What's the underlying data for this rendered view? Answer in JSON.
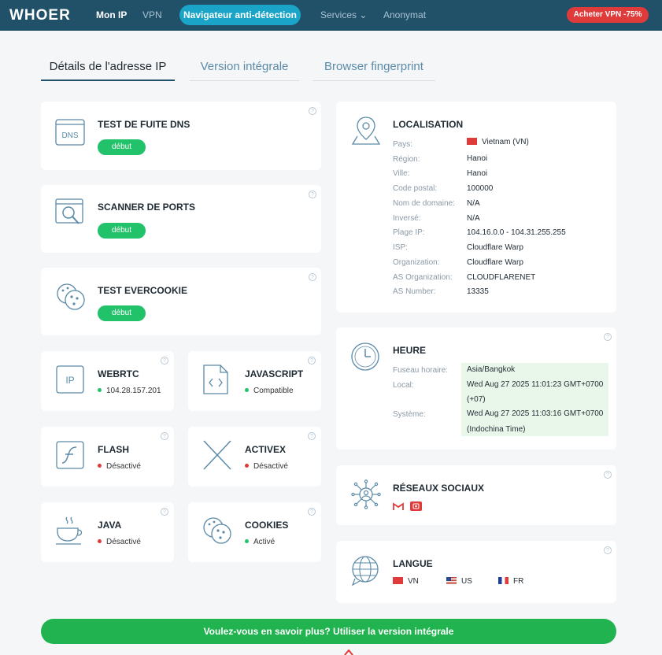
{
  "nav": {
    "logo": "WHOER",
    "items": [
      "Mon IP",
      "VPN",
      "Navigateur anti-détection",
      "Services ⌄",
      "Anonymat"
    ],
    "buy_label": "Acheter VPN -75%"
  },
  "tabs": [
    "Détails de l'adresse IP",
    "Version intégrale",
    "Browser fingerprint"
  ],
  "tests": {
    "dns": {
      "title": "TEST DE FUITE DNS",
      "button": "début",
      "icon_label": "DNS"
    },
    "ports": {
      "title": "SCANNER DE PORTS",
      "button": "début"
    },
    "evercookie": {
      "title": "TEST EVERCOOKIE",
      "button": "début"
    }
  },
  "tiles": {
    "webrtc": {
      "title": "WEBRTC",
      "status": "104.28.157.201",
      "icon_label": "IP"
    },
    "javascript": {
      "title": "JAVASCRIPT",
      "status": "Compatible"
    },
    "flash": {
      "title": "FLASH",
      "status": "Désactivé"
    },
    "activex": {
      "title": "ACTIVEX",
      "status": "Désactivé"
    },
    "java": {
      "title": "JAVA",
      "status": "Désactivé"
    },
    "cookies": {
      "title": "COOKIES",
      "status": "Activé"
    }
  },
  "location": {
    "title": "LOCALISATION",
    "rows": [
      {
        "label": "Pays:",
        "value": "Vietnam (VN)"
      },
      {
        "label": "Région:",
        "value": "Hanoi"
      },
      {
        "label": "Ville:",
        "value": "Hanoi"
      },
      {
        "label": "Code postal:",
        "value": "100000"
      },
      {
        "label": "Nom de domaine:",
        "value": "N/A"
      },
      {
        "label": "Inversé:",
        "value": "N/A"
      },
      {
        "label": "Plage IP:",
        "value": "104.16.0.0 - 104.31.255.255"
      },
      {
        "label": "ISP:",
        "value": "Cloudflare Warp"
      },
      {
        "label": "Organization:",
        "value": "Cloudflare Warp"
      },
      {
        "label": "AS Organization:",
        "value": "CLOUDFLARENET"
      },
      {
        "label": "AS Number:",
        "value": "13335"
      }
    ]
  },
  "time": {
    "title": "HEURE",
    "timezone_label": "Fuseau horaire:",
    "timezone_value": "Asia/Bangkok",
    "local_label": "Local:",
    "local_value_1": "Wed Aug 27 2025 11:01:23 GMT+0700",
    "local_value_2": "(+07)",
    "system_label": "Système:",
    "system_value_1": "Wed Aug 27 2025 11:03:16 GMT+0700",
    "system_value_2": "(Indochina Time)"
  },
  "social": {
    "title": "RÉSEAUX SOCIAUX",
    "icons": [
      "gmail-icon",
      "youtube-icon"
    ]
  },
  "language": {
    "title": "LANGUE",
    "items": [
      "VN",
      "US",
      "FR"
    ]
  },
  "cta_label": "Voulez-vous en savoir plus? Utiliser la version intégrale",
  "help_glyph": "?",
  "colors": {
    "nav": "#215069",
    "accent": "#19a4c8",
    "green": "#21c26a",
    "red": "#e03b3b",
    "cta": "#21b34f"
  }
}
